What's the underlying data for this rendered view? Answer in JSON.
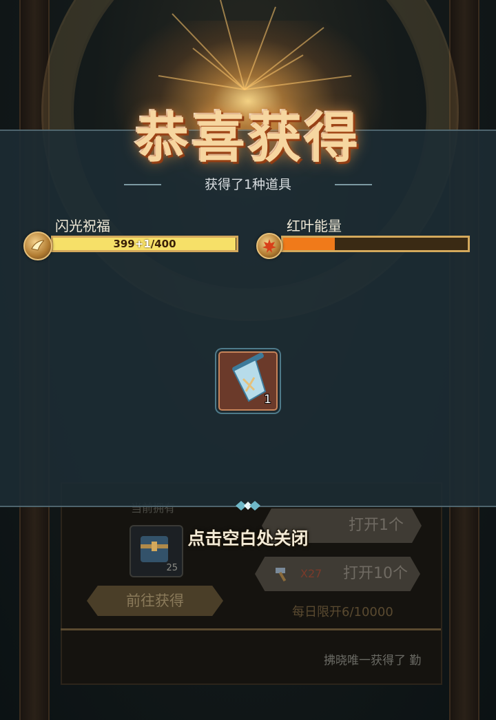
{
  "popup": {
    "title": "恭喜获得",
    "subtitle": "获得了1种道具",
    "close_hint": "点击空白处关闭"
  },
  "bars": {
    "flash": {
      "label": "闪光祝福",
      "value_text": "399",
      "plus_text": "+1",
      "max_text": "/400",
      "progress": 0.9975,
      "icon": "golden-wing-icon",
      "color": "#f6e068"
    },
    "redleaf": {
      "label": "红叶能量",
      "progress": 0.28,
      "icon": "maple-leaf-icon",
      "color": "#f07a1a"
    }
  },
  "reward": {
    "icon": "blue-scroll-banner-icon",
    "count": "1"
  },
  "background": {
    "current_label": "当前拥有",
    "item_count": "25",
    "goto_button": "前往获得",
    "open1_button": "打开1个",
    "open10_multiplier": "X27",
    "open10_button": "打开10个",
    "daily_limit": "每日限开6/10000",
    "ticker": "拂晓唯一获得了 勤"
  }
}
